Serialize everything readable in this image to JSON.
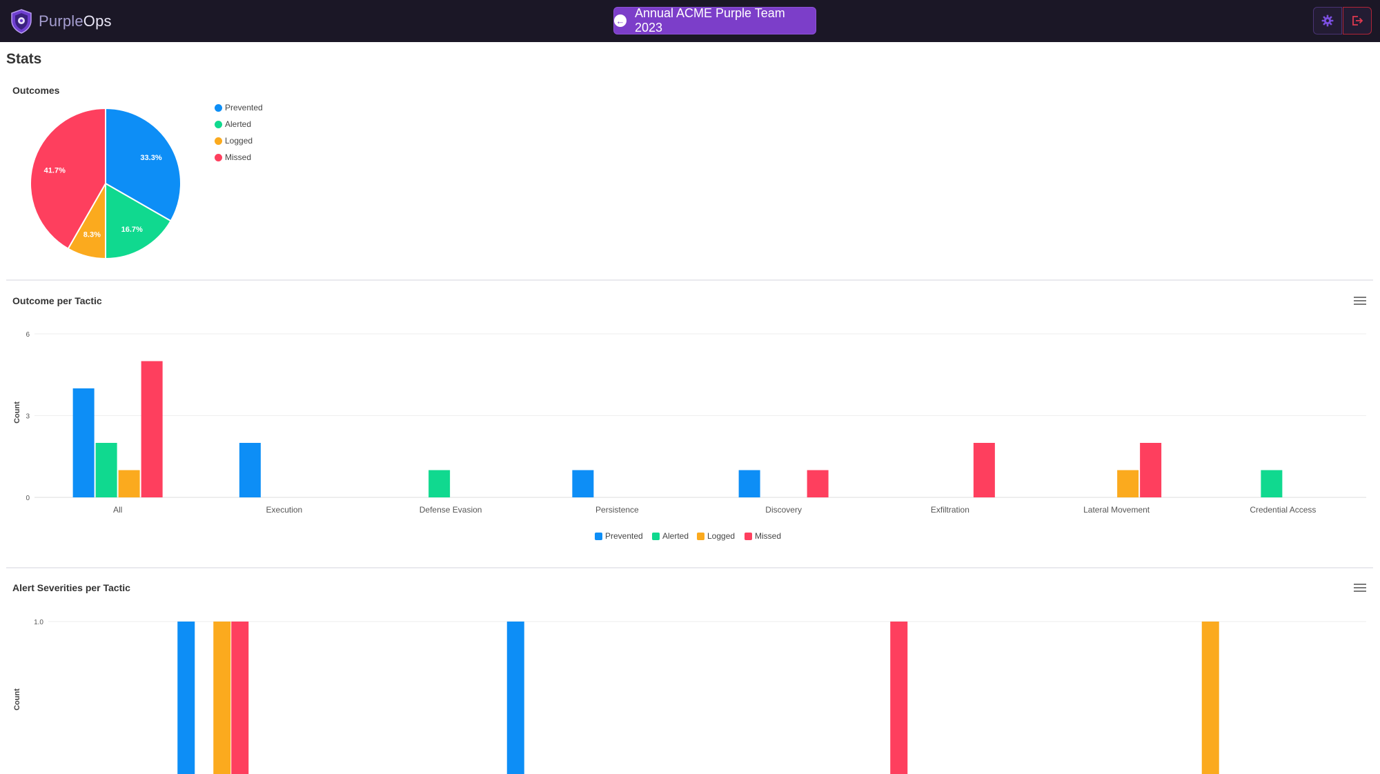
{
  "app": {
    "brand_purple": "Purple",
    "brand_ops": "Ops",
    "campaign_label": "Annual ACME Purple Team 2023",
    "settings_icon": "gear-icon",
    "logout_icon": "logout-icon"
  },
  "page": {
    "title": "Stats"
  },
  "colors": {
    "Prevented": "#0d8ef6",
    "Alerted": "#10d98f",
    "Logged": "#fbaa1e",
    "Missed": "#fe3f5e"
  },
  "chart_data": [
    {
      "type": "pie",
      "title": "Outcomes",
      "labels": [
        "Prevented",
        "Alerted",
        "Logged",
        "Missed"
      ],
      "values": [
        33.3,
        16.7,
        8.3,
        41.7
      ],
      "value_labels": [
        "33.3%",
        "16.7%",
        "8.3%",
        "41.7%"
      ],
      "legend": "right"
    },
    {
      "type": "bar",
      "title": "Outcome per Tactic",
      "ylabel": "Count",
      "categories": [
        "All",
        "Execution",
        "Defense Evasion",
        "Persistence",
        "Discovery",
        "Exfiltration",
        "Lateral Movement",
        "Credential Access"
      ],
      "yticks": [
        "0",
        "3",
        "6"
      ],
      "ylim": [
        0,
        6
      ],
      "legend": "bottom",
      "series": [
        {
          "name": "Prevented",
          "values": [
            4,
            2,
            0,
            1,
            1,
            0,
            0,
            0
          ]
        },
        {
          "name": "Alerted",
          "values": [
            2,
            0,
            1,
            0,
            0,
            0,
            0,
            1
          ]
        },
        {
          "name": "Logged",
          "values": [
            1,
            0,
            0,
            0,
            0,
            0,
            1,
            0
          ]
        },
        {
          "name": "Missed",
          "values": [
            5,
            0,
            0,
            0,
            1,
            2,
            2,
            0
          ]
        }
      ]
    },
    {
      "type": "bar",
      "title": "Alert Severities per Tactic",
      "ylabel": "Count",
      "yticks": [
        "1.0"
      ],
      "ylim": [
        0,
        1
      ],
      "series": [
        {
          "name": "Prevented",
          "values": [
            1,
            1,
            0,
            0
          ]
        },
        {
          "name": "Alerted",
          "values": [
            0,
            0,
            0,
            0
          ]
        },
        {
          "name": "Logged",
          "values": [
            1,
            0,
            0,
            1
          ]
        },
        {
          "name": "Missed",
          "values": [
            1,
            0,
            1,
            0
          ]
        }
      ]
    }
  ]
}
